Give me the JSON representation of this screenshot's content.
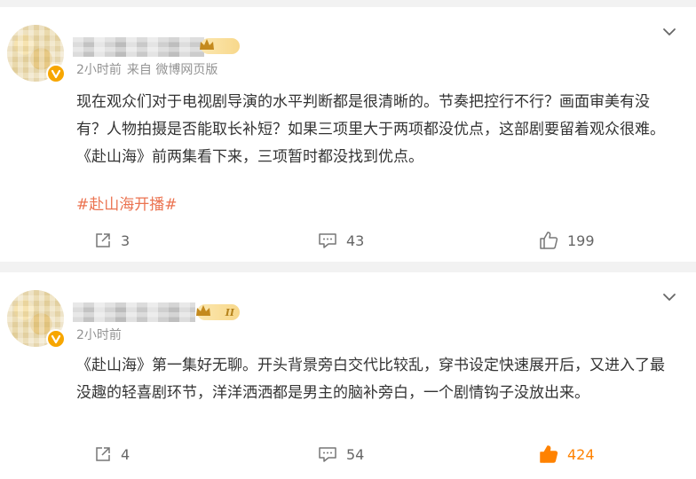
{
  "posts": [
    {
      "time": "2小时前",
      "source": "来自 微博网页版",
      "rank": "",
      "text": "现在观众们对于电视剧导演的水平判断都是很清晰的。节奏把控行不行？画面审美有没有？人物拍摄是否能取长补短？如果三项里大于两项都没优点，这部剧要留着观众很难。《赴山海》前两集看下来，三项暂时都没找到优点。",
      "topic": "#赴山海开播#",
      "forward_count": "3",
      "comment_count": "43",
      "like_count": "199",
      "liked": false
    },
    {
      "time": "2小时前",
      "source": "",
      "rank": "II",
      "text": "《赴山海》第一集好无聊。开头背景旁白交代比较乱，穿书设定快速展开后，又进入了最没趣的轻喜剧环节，洋洋洒洒都是男主的脑补旁白，一个剧情钩子没放出来。",
      "topic": "",
      "forward_count": "4",
      "comment_count": "54",
      "like_count": "424",
      "liked": true
    }
  ],
  "colors": {
    "topic": "#eb7350",
    "like_active": "#ff8200",
    "verified": "#f7a600",
    "meta": "#939393"
  },
  "icons": [
    "chevron-down-icon",
    "verified-icon",
    "crown-icon",
    "forward-icon",
    "comment-icon",
    "like-icon"
  ]
}
